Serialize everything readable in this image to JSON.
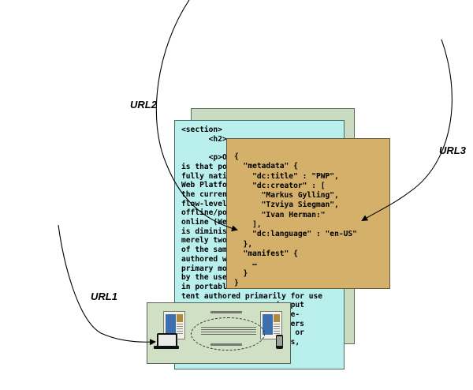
{
  "labels": {
    "url1": "URL1",
    "url2": "URL2",
    "url3": "URL3"
  },
  "html_document": {
    "lines": [
      "<section>",
      "      <h2>",
      "",
      "      <p>On",
      "is that po",
      "fully nati",
      "Web Platfo",
      "the curren",
      "flow-level",
      "offline/po",
      "online (We",
      "is diminis",
      "merely two",
      "of the sam",
      "authored w",
      "primary mo",
      "by the use",
      "in portable",
      "tent authored primarily for use",
      "                  an be put",
      "                   for re-",
      "                  ublishers",
      "                    ther or",
      "                    modes,"
    ]
  },
  "json_manifest": {
    "lines": [
      "{",
      "  \"metadata\" {",
      "    \"dc:title\" : \"PWP\",",
      "    \"dc:creator\" : [",
      "      \"Markus Gylling\",",
      "      \"Tzviya Siegman\",",
      "      \"Ivan Herman:\"",
      "    ],",
      "    \"dc:language\" : \"en-US\"",
      "  },",
      "  \"manifest\" {",
      "    …",
      "  }",
      "}"
    ]
  },
  "colors": {
    "html_doc": "#b9f0ee",
    "back_doc": "#c9dcc1",
    "json_doc": "#d4b06a",
    "device_panel": "#cfe0c4"
  }
}
